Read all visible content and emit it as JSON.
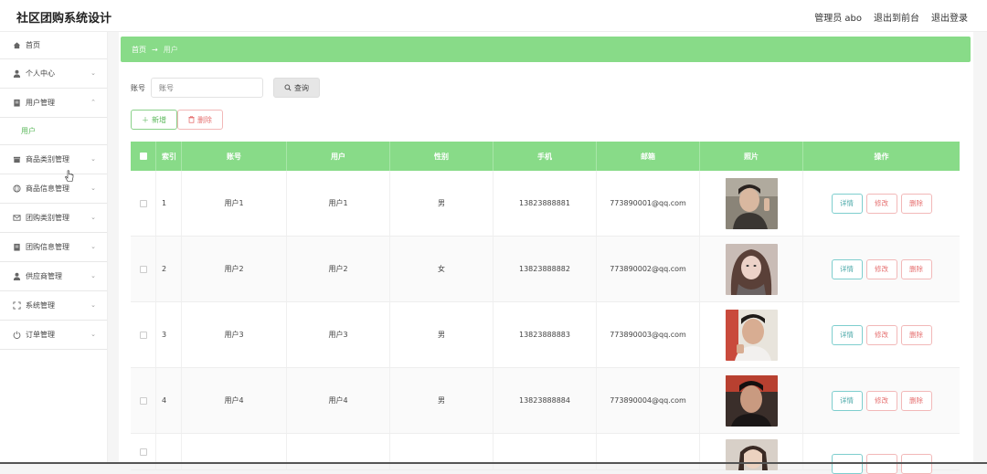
{
  "app": {
    "title": "社区团购系统设计"
  },
  "header": {
    "admin": "管理员 abo",
    "front": "退出到前台",
    "logout": "退出登录"
  },
  "sidebar": {
    "items": [
      {
        "label": "首页",
        "icon": "home-icon"
      },
      {
        "label": "个人中心",
        "icon": "user-icon"
      },
      {
        "label": "用户管理",
        "icon": "clipboard-icon"
      },
      {
        "label": "商品类别管理",
        "icon": "store-icon"
      },
      {
        "label": "商品信息管理",
        "icon": "globe-icon"
      },
      {
        "label": "团购类别管理",
        "icon": "mail-icon"
      },
      {
        "label": "团购信息管理",
        "icon": "clipboard-icon"
      },
      {
        "label": "供应商管理",
        "icon": "user-icon"
      },
      {
        "label": "系统管理",
        "icon": "expand-icon"
      },
      {
        "label": "订单管理",
        "icon": "power-icon"
      }
    ],
    "sub_user": "用户"
  },
  "breadcrumb": {
    "home": "首页",
    "arrow": "→",
    "current": "用户"
  },
  "search": {
    "label": "账号",
    "placeholder": "账号",
    "button": "查询"
  },
  "actions": {
    "add": "新增",
    "delete": "删除"
  },
  "table": {
    "headers": {
      "index": "索引",
      "account": "账号",
      "user": "用户",
      "gender": "性别",
      "phone": "手机",
      "email": "邮箱",
      "photo": "照片",
      "ops": "操作"
    },
    "rows": [
      {
        "index": "1",
        "account": "用户1",
        "user": "用户1",
        "gender": "男",
        "phone": "13823888881",
        "email": "773890001@qq.com"
      },
      {
        "index": "2",
        "account": "用户2",
        "user": "用户2",
        "gender": "女",
        "phone": "13823888882",
        "email": "773890002@qq.com"
      },
      {
        "index": "3",
        "account": "用户3",
        "user": "用户3",
        "gender": "男",
        "phone": "13823888883",
        "email": "773890003@qq.com"
      },
      {
        "index": "4",
        "account": "用户4",
        "user": "用户4",
        "gender": "男",
        "phone": "13823888884",
        "email": "773890004@qq.com"
      }
    ],
    "op_labels": {
      "detail": "详情",
      "edit": "修改",
      "delete": "删除"
    }
  },
  "colors": {
    "accent": "#88db88",
    "danger": "#e67272",
    "info": "#4aa8a8"
  }
}
